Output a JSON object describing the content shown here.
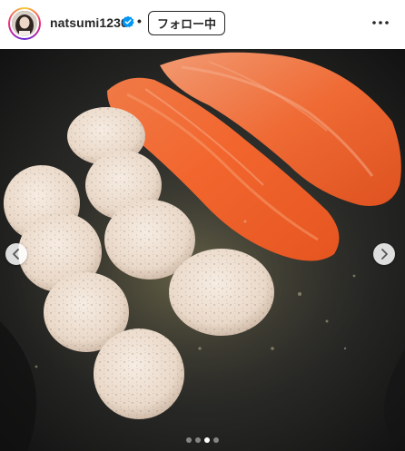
{
  "post": {
    "username": "natsumi1230",
    "separator": "•",
    "follow_label": "フォロー中",
    "verified": true
  },
  "icons": {
    "verified": "verified-badge-icon",
    "more": "more-options-icon",
    "prev": "chevron-left-icon",
    "next": "chevron-right-icon"
  },
  "carousel": {
    "total_slides": 4,
    "active_slide": 3
  },
  "colors": {
    "verified_blue": "#0095f6",
    "text": "#262626",
    "salmon": "#f2662e",
    "scallop": "#efe2d6"
  }
}
